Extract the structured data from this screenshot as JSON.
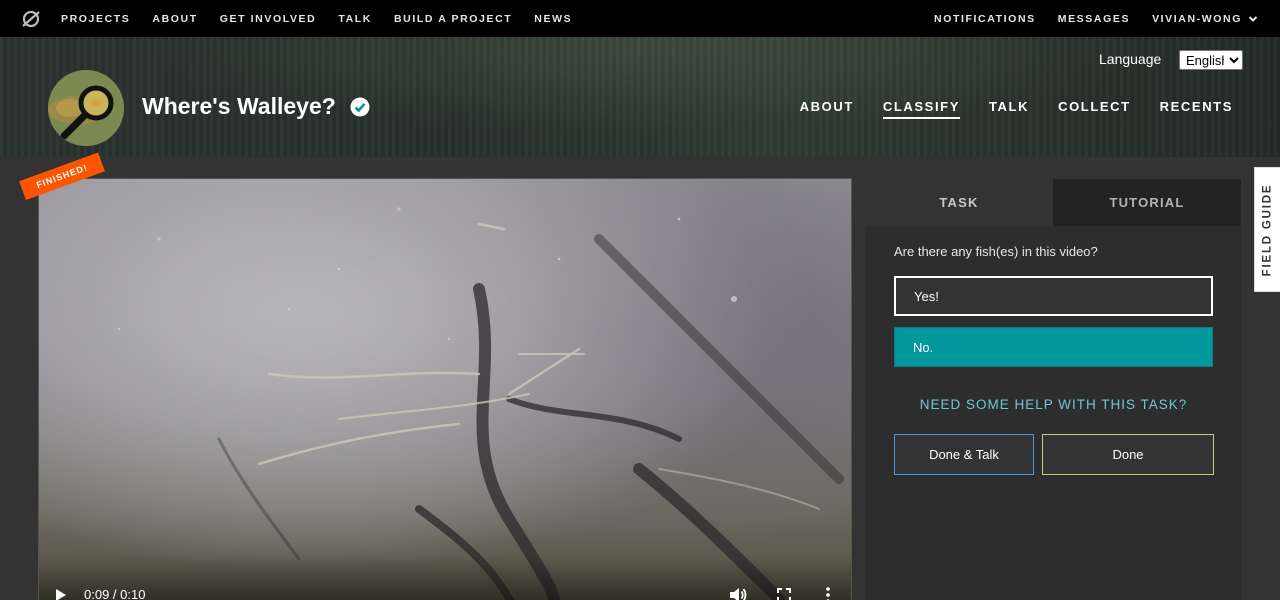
{
  "topbar": {
    "nav": [
      "Projects",
      "About",
      "Get Involved",
      "Talk",
      "Build a Project",
      "News"
    ],
    "right": [
      "Notifications",
      "Messages"
    ],
    "user": "vivian-wong"
  },
  "project": {
    "title": "Where's Walleye?",
    "language_label": "Language",
    "language_value": "English",
    "nav": [
      "ABOUT",
      "CLASSIFY",
      "TALK",
      "COLLECT",
      "RECENTS"
    ],
    "active_nav": "CLASSIFY"
  },
  "video": {
    "time": "0:09 / 0:10",
    "ribbon": "FINISHED!"
  },
  "task": {
    "tabs": [
      "TASK",
      "TUTORIAL"
    ],
    "question": "Are there any fish(es) in this video?",
    "answers": [
      "Yes!",
      "No."
    ],
    "selected": "No.",
    "help": "NEED SOME HELP WITH THIS TASK?",
    "done_talk": "Done & Talk",
    "done": "Done"
  },
  "field_guide": "FIELD GUIDE",
  "colors": {
    "accent_teal": "#00979d",
    "ribbon": "#ff5400",
    "done_talk_border": "#4c97d8",
    "done_border": "#b7d47c"
  }
}
